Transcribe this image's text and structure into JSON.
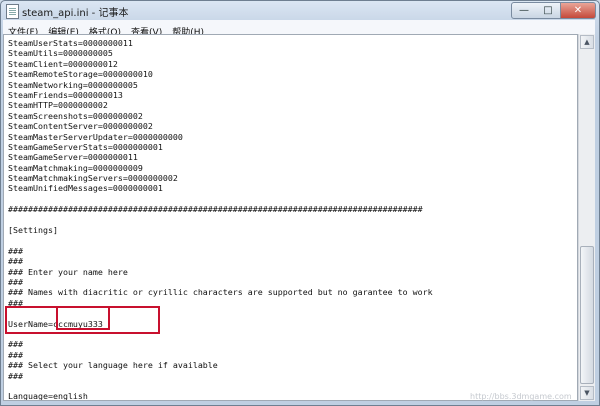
{
  "window": {
    "title": "steam_api.ini - 记事本",
    "controls": {
      "minimize": "—",
      "maximize": "□",
      "close": "✕"
    }
  },
  "menu": [
    {
      "label": "文件(F)"
    },
    {
      "label": "编辑(E)"
    },
    {
      "label": "格式(O)"
    },
    {
      "label": "查看(V)"
    },
    {
      "label": "帮助(H)"
    }
  ],
  "editor": {
    "lines": [
      "SteamUserStats=0000000011",
      "SteamUtils=0000000005",
      "SteamClient=0000000012",
      "SteamRemoteStorage=0000000010",
      "SteamNetworking=0000000005",
      "SteamFriends=0000000013",
      "SteamHTTP=0000000002",
      "SteamScreenshots=0000000002",
      "SteamContentServer=0000000002",
      "SteamMasterServerUpdater=0000000000",
      "SteamGameServerStats=0000000001",
      "SteamGameServer=0000000011",
      "SteamMatchmaking=0000000009",
      "SteamMatchmakingServers=0000000002",
      "SteamUnifiedMessages=0000000001",
      "",
      "###################################################################################",
      "",
      "[Settings]",
      "",
      "###",
      "###",
      "### Enter your name here",
      "###",
      "### Names with diacritic or cyrillic characters are supported but no garantee to work",
      "###",
      "",
      "UserName=cccmuyu333",
      "",
      "###",
      "###",
      "### Select your language here if available",
      "###",
      "",
      "Language=english"
    ]
  },
  "scrollbar": {
    "up_arrow": "▲",
    "down_arrow": "▼"
  },
  "watermark": "http://bbs.3dmgame.com"
}
